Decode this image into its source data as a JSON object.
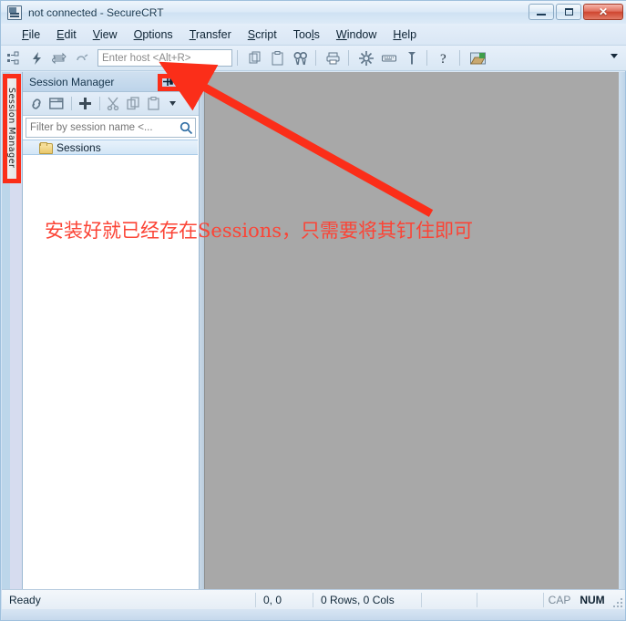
{
  "window": {
    "title": "not connected - SecureCRT",
    "app_icon": "securecrt-icon",
    "controls": {
      "minimize": "–",
      "maximize": "□",
      "close": "✕"
    }
  },
  "menubar": {
    "items": [
      {
        "label": "File",
        "accel": "F"
      },
      {
        "label": "Edit",
        "accel": "E"
      },
      {
        "label": "View",
        "accel": "V"
      },
      {
        "label": "Options",
        "accel": "O"
      },
      {
        "label": "Transfer",
        "accel": "T"
      },
      {
        "label": "Script",
        "accel": "S"
      },
      {
        "label": "Tools",
        "accel": "l"
      },
      {
        "label": "Window",
        "accel": "W"
      },
      {
        "label": "Help",
        "accel": "H"
      }
    ]
  },
  "toolbar": {
    "host_placeholder": "Enter host <Alt+R>",
    "host_value": "",
    "icons": [
      "session-manager-icon",
      "quick-connect-icon",
      "reconnect-icon",
      "disconnect-icon",
      "clone-session-icon",
      "paste-icon",
      "find-icon",
      "print-icon",
      "session-options-icon",
      "keymap-editor-icon",
      "key-icon",
      "help-icon",
      "secure-file-transfer-icon"
    ],
    "overflow": "chevron-down-icon"
  },
  "sidebar_tab": {
    "label": "Session Manager"
  },
  "session_manager": {
    "title": "Session Manager",
    "pin_button": "⊣",
    "close_button": "✕",
    "toolbar_icons": [
      "connect-icon",
      "connect-in-new-tab-icon",
      "new-session-icon",
      "cut-icon",
      "copy-icon",
      "paste-icon",
      "more-icon"
    ],
    "filter": {
      "placeholder": "Filter by session name <...",
      "value": "",
      "search_icon": "search-icon"
    },
    "tree": [
      {
        "label": "Sessions",
        "icon": "folder-icon",
        "selected": true
      }
    ]
  },
  "terminal": {
    "content": "",
    "background": "#a8a8a8"
  },
  "statusbar": {
    "ready": "Ready",
    "cursor": "0, 0",
    "dimensions": "0 Rows, 0 Cols",
    "field4": "",
    "field5": "",
    "cap": "CAP",
    "num": "NUM"
  },
  "annotations": {
    "color": "#fb2e19",
    "note_text": "安装好就已经存在Sessions，只需要将其钉住即可",
    "boxes": [
      {
        "name": "session-manager-vertical-tab-highlight"
      },
      {
        "name": "pin-button-highlight"
      },
      {
        "name": "close-button-highlight"
      }
    ],
    "arrow": {
      "name": "arrow-to-pin-button",
      "from": "472,233",
      "to": "212,88"
    }
  }
}
